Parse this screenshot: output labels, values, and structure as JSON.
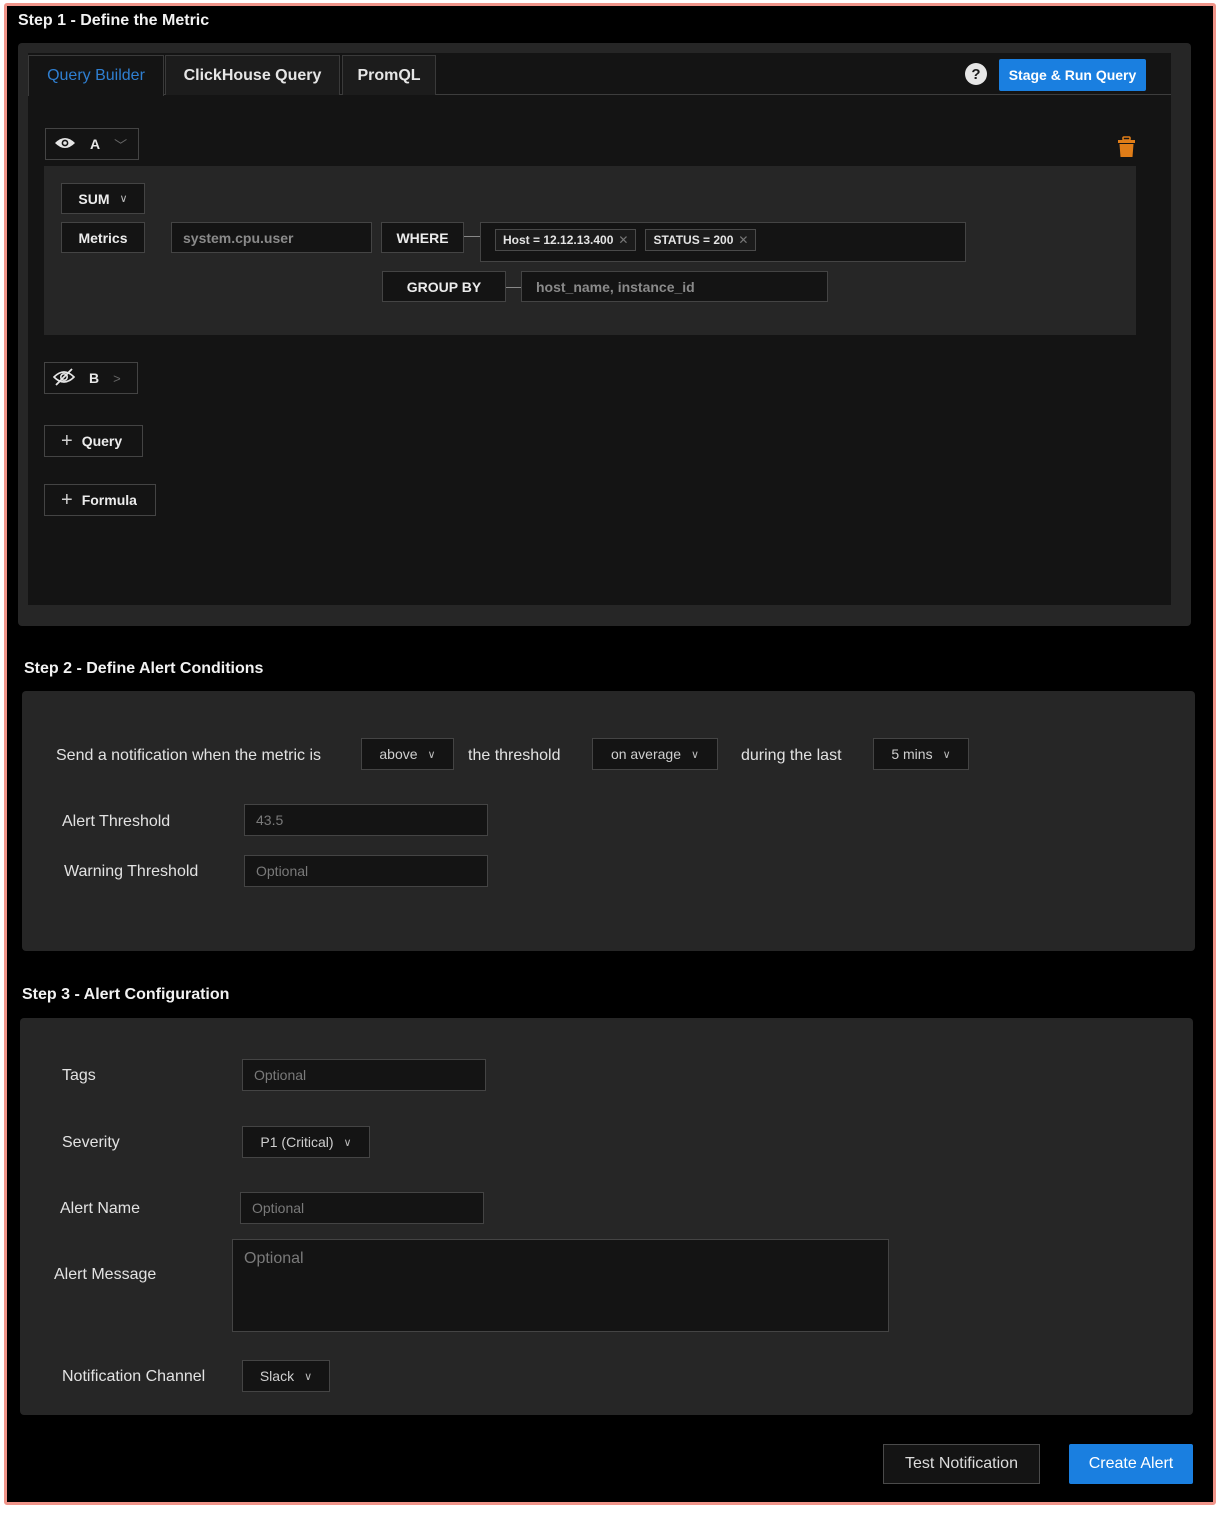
{
  "step1": {
    "title": "Step 1 - Define the Metric",
    "tabs": [
      {
        "label": "Query Builder",
        "active": true
      },
      {
        "label": "ClickHouse Query",
        "active": false
      },
      {
        "label": "PromQL",
        "active": false
      }
    ],
    "help_icon": "?",
    "run_button": "Stage &  Run Query",
    "query_a": {
      "name": "A",
      "visible": true,
      "aggregation": "SUM",
      "metrics_label": "Metrics",
      "metric_value": "system.cpu.user",
      "where_label": "WHERE",
      "filters": [
        {
          "label": "Host =  12.12.13.400"
        },
        {
          "label": "STATUS = 200"
        }
      ],
      "group_by_label": "GROUP BY",
      "group_by_value": "host_name, instance_id"
    },
    "query_b": {
      "name": "B",
      "visible": false
    },
    "add_query_label": "Query",
    "add_formula_label": "Formula",
    "accent_color": "#1a7fe0",
    "delete_icon_color": "#e07d18"
  },
  "step2": {
    "title": "Step 2 - Define Alert Conditions",
    "sentence_start": "Send a notification when  the metric is",
    "comparison": "above",
    "threshold_text": "the threshold",
    "match_type": "on average",
    "during_text": "during the last",
    "window": "5 mins",
    "alert_threshold_label": "Alert Threshold",
    "alert_threshold_value": "43.5",
    "warning_threshold_label": "Warning Threshold",
    "warning_threshold_placeholder": "Optional"
  },
  "step3": {
    "title": "Step 3 - Alert Configuration",
    "tags_label": "Tags",
    "tags_placeholder": "Optional",
    "severity_label": "Severity",
    "severity_value": "P1 (Critical)",
    "alert_name_label": "Alert Name",
    "alert_name_placeholder": "Optional",
    "alert_message_label": "Alert Message",
    "alert_message_placeholder": "Optional",
    "channel_label": "Notification Channel",
    "channel_value": "Slack"
  },
  "footer": {
    "test_button": "Test Notification",
    "create_button": "Create Alert"
  }
}
